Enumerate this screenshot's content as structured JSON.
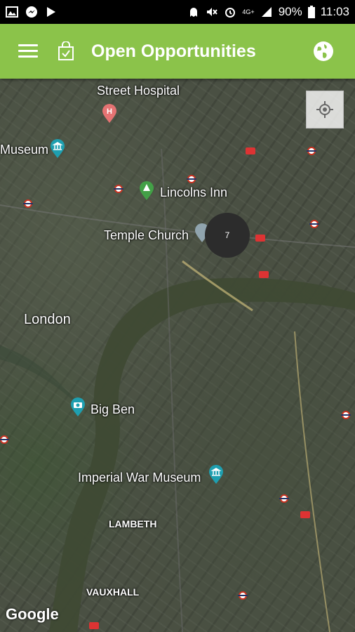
{
  "status_bar": {
    "battery": "90%",
    "time": "11:03",
    "network": "4G+"
  },
  "app_bar": {
    "title": "Open Opportunities",
    "menu_icon": "hamburger-menu-icon",
    "bag_icon": "shopping-bag-check-icon",
    "globe_icon": "globe-icon",
    "color": "#8bc34a"
  },
  "map": {
    "labels": {
      "street_hospital": "Street Hospital",
      "museum": "Museum",
      "lincolns_inn": "Lincolns Inn",
      "temple_church": "Temple Church",
      "london": "London",
      "big_ben": "Big Ben",
      "imperial_war_museum": "Imperial War Museum",
      "lambeth": "LAMBETH",
      "vauxhall": "VAUXHALL"
    },
    "cluster_count": "7",
    "attribution": "Google"
  }
}
